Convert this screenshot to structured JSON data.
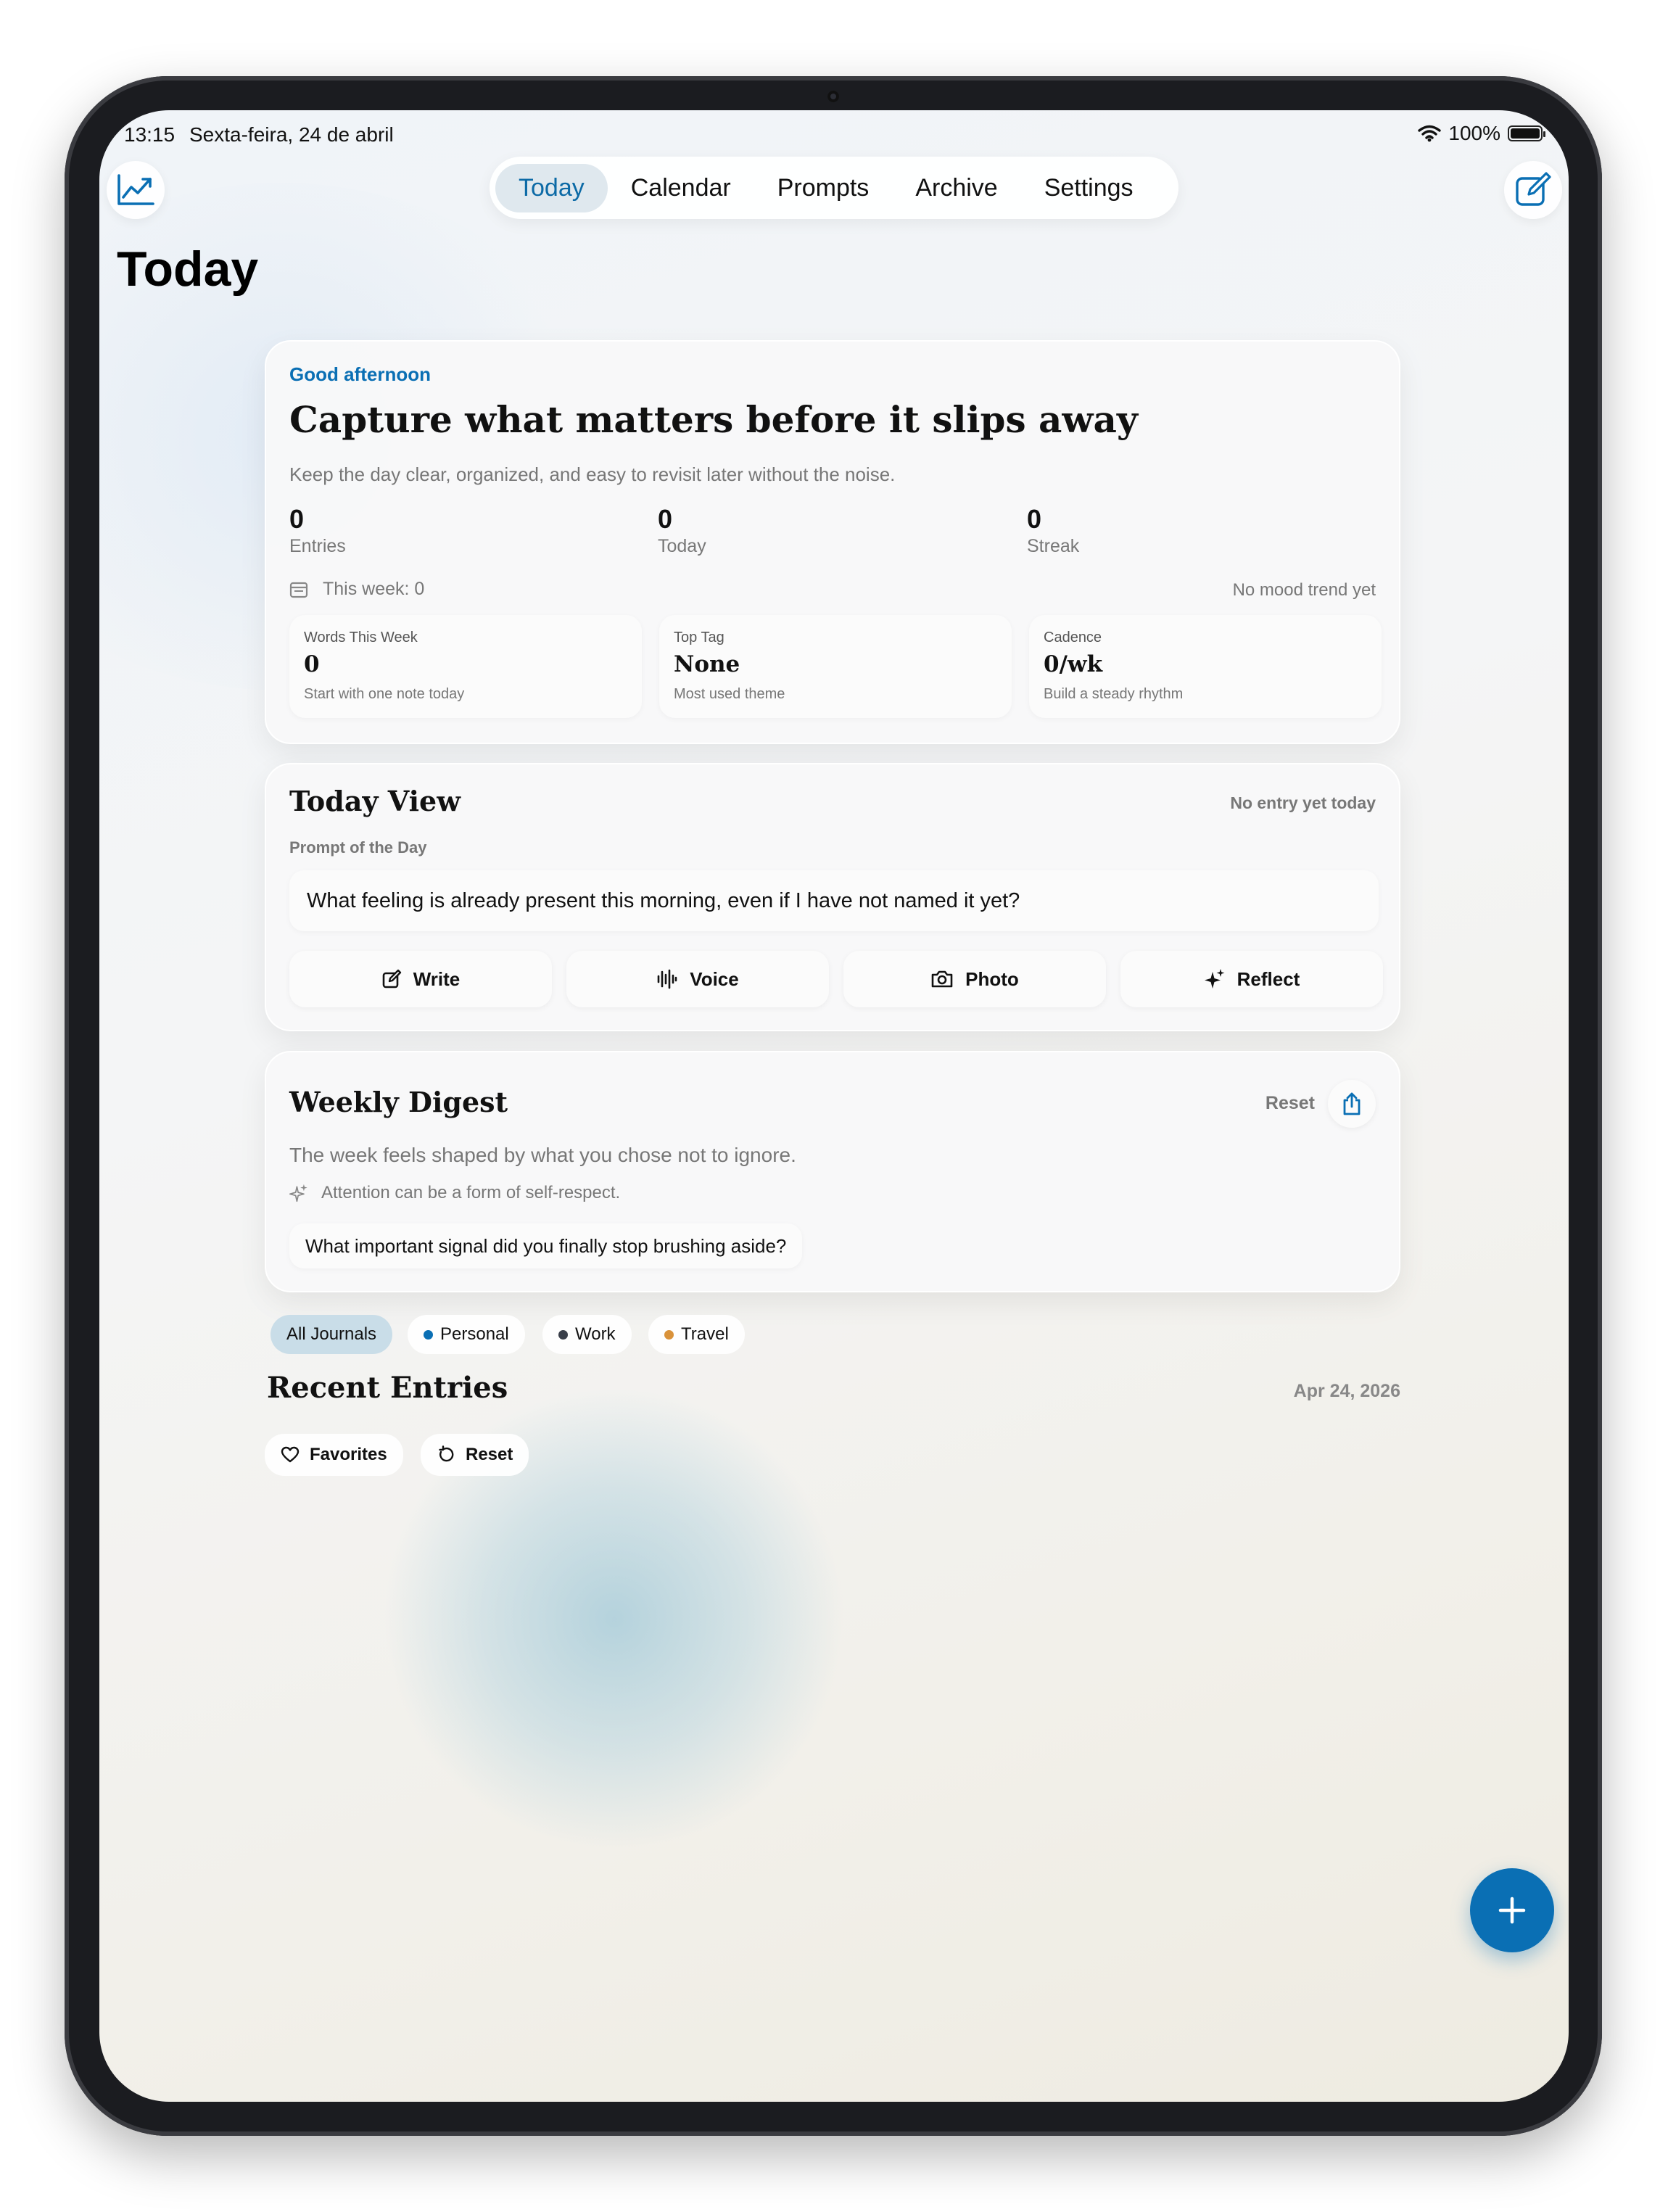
{
  "status_bar": {
    "time": "13:15",
    "date": "Sexta-feira, 24 de abril",
    "battery": "100%"
  },
  "header": {
    "left_icon": "chart-trend-icon",
    "right_icon": "compose-icon",
    "tabs": [
      {
        "label": "Today",
        "active": true
      },
      {
        "label": "Calendar",
        "active": false
      },
      {
        "label": "Prompts",
        "active": false
      },
      {
        "label": "Archive",
        "active": false
      },
      {
        "label": "Settings",
        "active": false
      }
    ]
  },
  "page_title": "Today",
  "hero": {
    "greeting": "Good afternoon",
    "title": "Capture what matters before it slips away",
    "subtitle": "Keep the day clear, organized, and easy to revisit later without the noise.",
    "stats": [
      {
        "value": "0",
        "label": "Entries"
      },
      {
        "value": "0",
        "label": "Today"
      },
      {
        "value": "0",
        "label": "Streak"
      }
    ],
    "this_week": "This week: 0",
    "mood_trend": "No mood trend yet",
    "mini_cards": [
      {
        "label": "Words This Week",
        "value": "0",
        "sub": "Start with one note today"
      },
      {
        "label": "Top Tag",
        "value": "None",
        "sub": "Most used theme"
      },
      {
        "label": "Cadence",
        "value": "0/wk",
        "sub": "Build a steady rhythm"
      }
    ]
  },
  "today_view": {
    "title": "Today View",
    "status": "No entry yet today",
    "prompt_label": "Prompt of the Day",
    "prompt": "What feeling is already present this morning, even if I have not named it yet?",
    "actions": [
      {
        "label": "Write",
        "icon": "write-icon"
      },
      {
        "label": "Voice",
        "icon": "waveform-icon"
      },
      {
        "label": "Photo",
        "icon": "camera-icon"
      },
      {
        "label": "Reflect",
        "icon": "sparkle-icon"
      }
    ]
  },
  "weekly_digest": {
    "title": "Weekly Digest",
    "reset_label": "Reset",
    "summary": "The week feels shaped by what you chose not to ignore.",
    "insight": "Attention can be a form of self-respect.",
    "question": "What important signal did you finally stop brushing aside?"
  },
  "filters": [
    {
      "label": "All Journals",
      "active": true,
      "color": ""
    },
    {
      "label": "Personal",
      "active": false,
      "color": "#0a6fb4"
    },
    {
      "label": "Work",
      "active": false,
      "color": "#3a3f4a"
    },
    {
      "label": "Travel",
      "active": false,
      "color": "#d9923a"
    }
  ],
  "recent": {
    "title": "Recent Entries",
    "date": "Apr 24, 2026",
    "favorites_label": "Favorites",
    "reset_label": "Reset"
  },
  "colors": {
    "accent": "#0a6fb4",
    "active_tab_bg": "#dfe8ee"
  }
}
